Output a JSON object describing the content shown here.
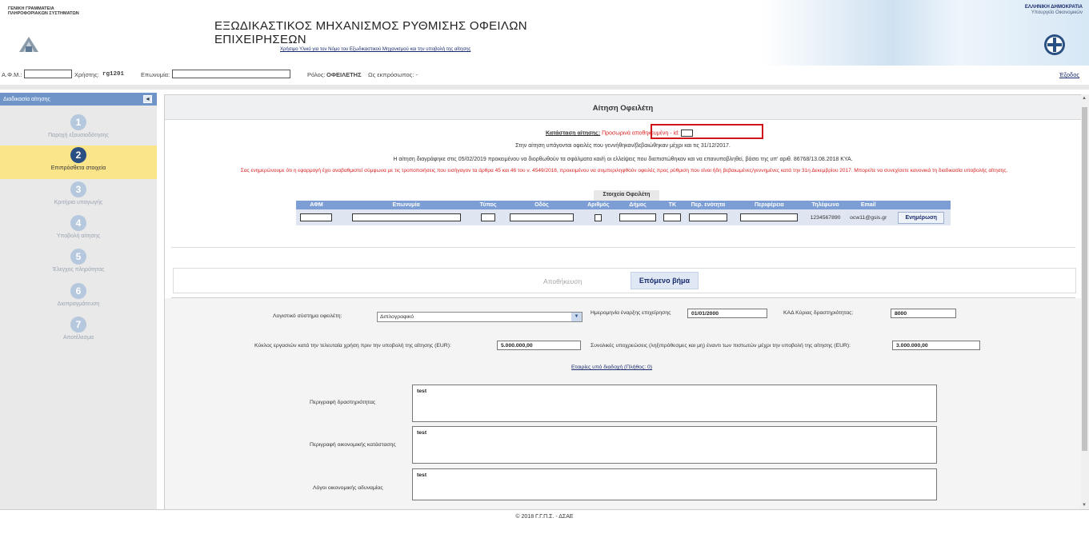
{
  "header": {
    "gsis_line1": "ΓΕΝΙΚΗ ΓΡΑΜΜΑΤΕΙΑ",
    "gsis_line2": "ΠΛΗΡΟΦΟΡΙΑΚΩΝ ΣΥΣΤΗΜΑΤΩΝ",
    "title": "ΕΞΩΔΙΚΑΣΤΙΚΟΣ ΜΗΧΑΝΙΣΜΟΣ ΡΥΘΜΙΣΗΣ ΟΦΕΙΛΩΝ ΕΠΙΧΕΙΡΗΣΕΩΝ",
    "link": "Χρήσιμο Υλικό για τον Νόμο του Εξωδικαστικού Μηχανισμού και την υποβολή της αίτησης",
    "gov_line1": "ΕΛΛΗΝΙΚΗ ΔΗΜΟΚΡΑΤΙΑ",
    "gov_line2": "Υπουργείο Οικονομικών"
  },
  "userbar": {
    "afm_label": "Α.Φ.Μ.:",
    "user_label": "Χρήστης:",
    "user_value": "rg1201",
    "name_label": "Επωνυμία:",
    "role_label": "Ρόλος:",
    "role_value": "ΟΦΕΙΛΕΤΗΣ",
    "rep_text": "Ως εκπρόσωπος: -",
    "exit": "Έξοδος"
  },
  "sidebar": {
    "title": "Διαδικασία αίτησης",
    "toggle": "◂",
    "steps": [
      {
        "num": "1",
        "label": "Παροχή εξουσιοδότησης"
      },
      {
        "num": "2",
        "label": "Επιπρόσθετα στοιχεία"
      },
      {
        "num": "3",
        "label": "Κριτήρια υπαγωγής"
      },
      {
        "num": "4",
        "label": "Υποβολή αίτησης"
      },
      {
        "num": "5",
        "label": "Έλεγχος πληρότητας"
      },
      {
        "num": "6",
        "label": "Διαπραγμάτευση"
      },
      {
        "num": "7",
        "label": "Αποτέλεσμα"
      }
    ],
    "active_step": 2
  },
  "panel": {
    "title": "Αίτηση Οφειλέτη",
    "status_label": "Κατάσταση αίτησης:",
    "status_value": "Προσωρινά αποθηκευμένη - id:",
    "line1": "Στην αίτηση υπάγονται οφειλές που γεννήθηκαν/βεβαιώθηκαν μέχρι και τις 31/12/2017.",
    "line2": "Η αίτηση διαγράφηκε στις 05/02/2019 προκειμένου να διορθωθούν τα σφάλματα και/ή οι ελλείψεις που διαπιστώθηκαν και να επανυποβληθεί, βάσει της υπ' αριθ. 86768/13.08.2018 ΚΥΑ.",
    "line3": "Σας ενημερώνουμε ότι η εφαρμογή έχει αναβαθμιστεί σύμφωνα με τις τροποποιήσεις που εισήγαγον τα άρθρα 45 και 46 του ν. 4549/2018, προκειμένου να συμπεριληφθούν οφειλές προς ρύθμιση που είναι ήδη βεβαιωμένες/γεννημένες κατά την 31η Δεκεμβρίου 2017. Μπορείτε να συνεχίσετε κανονικά τη διαδικασία υποβολής αίτησης."
  },
  "debtor": {
    "title": "Στοιχεία Οφειλέτη",
    "columns": [
      "ΑΦΜ",
      "Επωνυμία",
      "Τύπος",
      "Οδός",
      "Αριθμός",
      "Δήμος",
      "ΤΚ",
      "Περ. ενότητα",
      "Περιφέρεια",
      "Τηλέφωνο",
      "Email",
      ""
    ],
    "phone": "1234567890",
    "email": "ocw11@gsis.gr",
    "update_button": "Ενημέρωση"
  },
  "actions": {
    "save": "Αποθήκευση",
    "next": "Επόμενο βήμα"
  },
  "form": {
    "accounting_label": "Λογιστικό σύστημα οφειλέτη:",
    "accounting_value": "Διπλογραφικό",
    "start_date_label": "Ημερομηνία έναρξης επιχείρησης",
    "start_date_value": "01/01/2000",
    "kad_label": "ΚΑΔ Κύριας δραστηριότητας:",
    "kad_value": "8000",
    "turnover_label": "Κύκλος εργασιών κατά την τελευταία χρήση πριν την υποβολή της αίτησης (EUR):",
    "turnover_value": "5.000.000,00",
    "liabilities_label": "Συνολικές υποχρεώσεις (ληξιπρόθεσμες και μη) έναντι των πιστωτών μέχρι την υποβολή της αίτησης (EUR):",
    "liabilities_value": "3.000.000,00",
    "partners_link": "Εταιρίες υπό διαδοχή (Πλήθος: 0)",
    "activity_label": "Περιγραφή δραστηριότητας",
    "activity_value": "test",
    "financial_label": "Περιγραφή οικονομικής κατάστασης",
    "financial_value": "test",
    "reasons_label": "Λόγοι οικονομικής αδυναμίας",
    "reasons_value": "test"
  },
  "footer": "© 2018 Γ.Γ.Π.Σ. - ΔΣΑΕ"
}
